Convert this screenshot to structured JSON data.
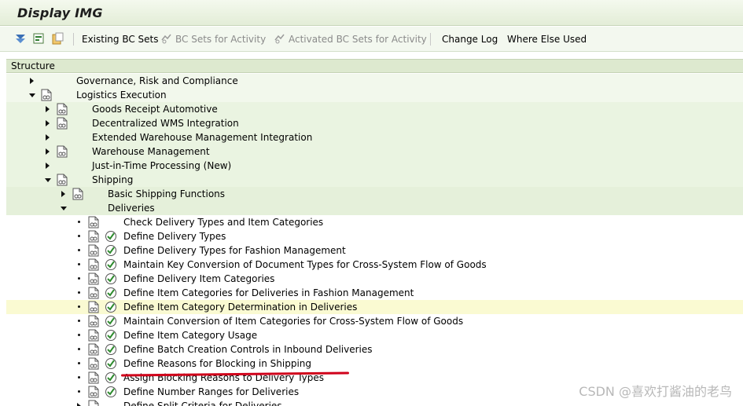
{
  "window": {
    "title": "Display IMG"
  },
  "toolbar": {
    "existing_bc_sets": "Existing BC Sets",
    "bc_sets_for_activity": "BC Sets for Activity",
    "activated_bc_sets_for_activity": "Activated BC Sets for Activity",
    "change_log": "Change Log",
    "where_else_used": "Where Else Used"
  },
  "tree": {
    "header": "Structure",
    "nodes": [
      {
        "label": "Governance, Risk and Compliance",
        "level": 0,
        "state": "collapsed",
        "doc": false
      },
      {
        "label": "Logistics Execution",
        "level": 0,
        "state": "expanded",
        "doc": true
      },
      {
        "label": "Goods Receipt Automotive",
        "level": 1,
        "state": "collapsed",
        "doc": true
      },
      {
        "label": "Decentralized WMS Integration",
        "level": 1,
        "state": "collapsed",
        "doc": true
      },
      {
        "label": "Extended Warehouse Management Integration",
        "level": 1,
        "state": "collapsed",
        "doc": false
      },
      {
        "label": "Warehouse Management",
        "level": 1,
        "state": "collapsed",
        "doc": true
      },
      {
        "label": "Just-in-Time Processing (New)",
        "level": 1,
        "state": "collapsed",
        "doc": false
      },
      {
        "label": "Shipping",
        "level": 1,
        "state": "expanded",
        "doc": true
      },
      {
        "label": "Basic Shipping Functions",
        "level": 2,
        "state": "collapsed",
        "doc": true
      },
      {
        "label": "Deliveries",
        "level": 2,
        "state": "expanded",
        "doc": false
      },
      {
        "label": "Check Delivery Types and Item Categories",
        "level": 3,
        "state": "leaf",
        "doc": true,
        "exec": false
      },
      {
        "label": "Define Delivery Types",
        "level": 3,
        "state": "leaf",
        "doc": true,
        "exec": true
      },
      {
        "label": "Define Delivery Types for Fashion Management",
        "level": 3,
        "state": "leaf",
        "doc": true,
        "exec": true
      },
      {
        "label": "Maintain Key Conversion of Document Types for Cross-System Flow of Goods",
        "level": 3,
        "state": "leaf",
        "doc": true,
        "exec": true
      },
      {
        "label": "Define Delivery Item Categories",
        "level": 3,
        "state": "leaf",
        "doc": true,
        "exec": true
      },
      {
        "label": "Define Item Categories for Deliveries in Fashion Management",
        "level": 3,
        "state": "leaf",
        "doc": true,
        "exec": true
      },
      {
        "label": "Define Item Category Determination in Deliveries",
        "level": 3,
        "state": "leaf",
        "doc": true,
        "exec": true,
        "highlighted": true
      },
      {
        "label": "Maintain Conversion of Item Categories for Cross-System Flow of Goods",
        "level": 3,
        "state": "leaf",
        "doc": true,
        "exec": true
      },
      {
        "label": "Define Item Category Usage",
        "level": 3,
        "state": "leaf",
        "doc": true,
        "exec": true
      },
      {
        "label": "Define Batch Creation Controls in Inbound Deliveries",
        "level": 3,
        "state": "leaf",
        "doc": true,
        "exec": true
      },
      {
        "label": "Define Reasons for Blocking in Shipping",
        "level": 3,
        "state": "leaf",
        "doc": true,
        "exec": true
      },
      {
        "label": "Assign Blocking Reasons to Delivery Types",
        "level": 3,
        "state": "leaf",
        "doc": true,
        "exec": true
      },
      {
        "label": "Define Number Ranges for Deliveries",
        "level": 3,
        "state": "leaf",
        "doc": true,
        "exec": true
      },
      {
        "label": "Define Split Criteria for Deliveries",
        "level": 3,
        "state": "collapsed",
        "doc": true,
        "exec": false
      }
    ]
  },
  "watermark": "CSDN @喜欢打酱油的老鸟",
  "colors": {
    "highlight": "#fafad2",
    "annotation": "#d0021b",
    "header_bg": "#dde9cf"
  }
}
